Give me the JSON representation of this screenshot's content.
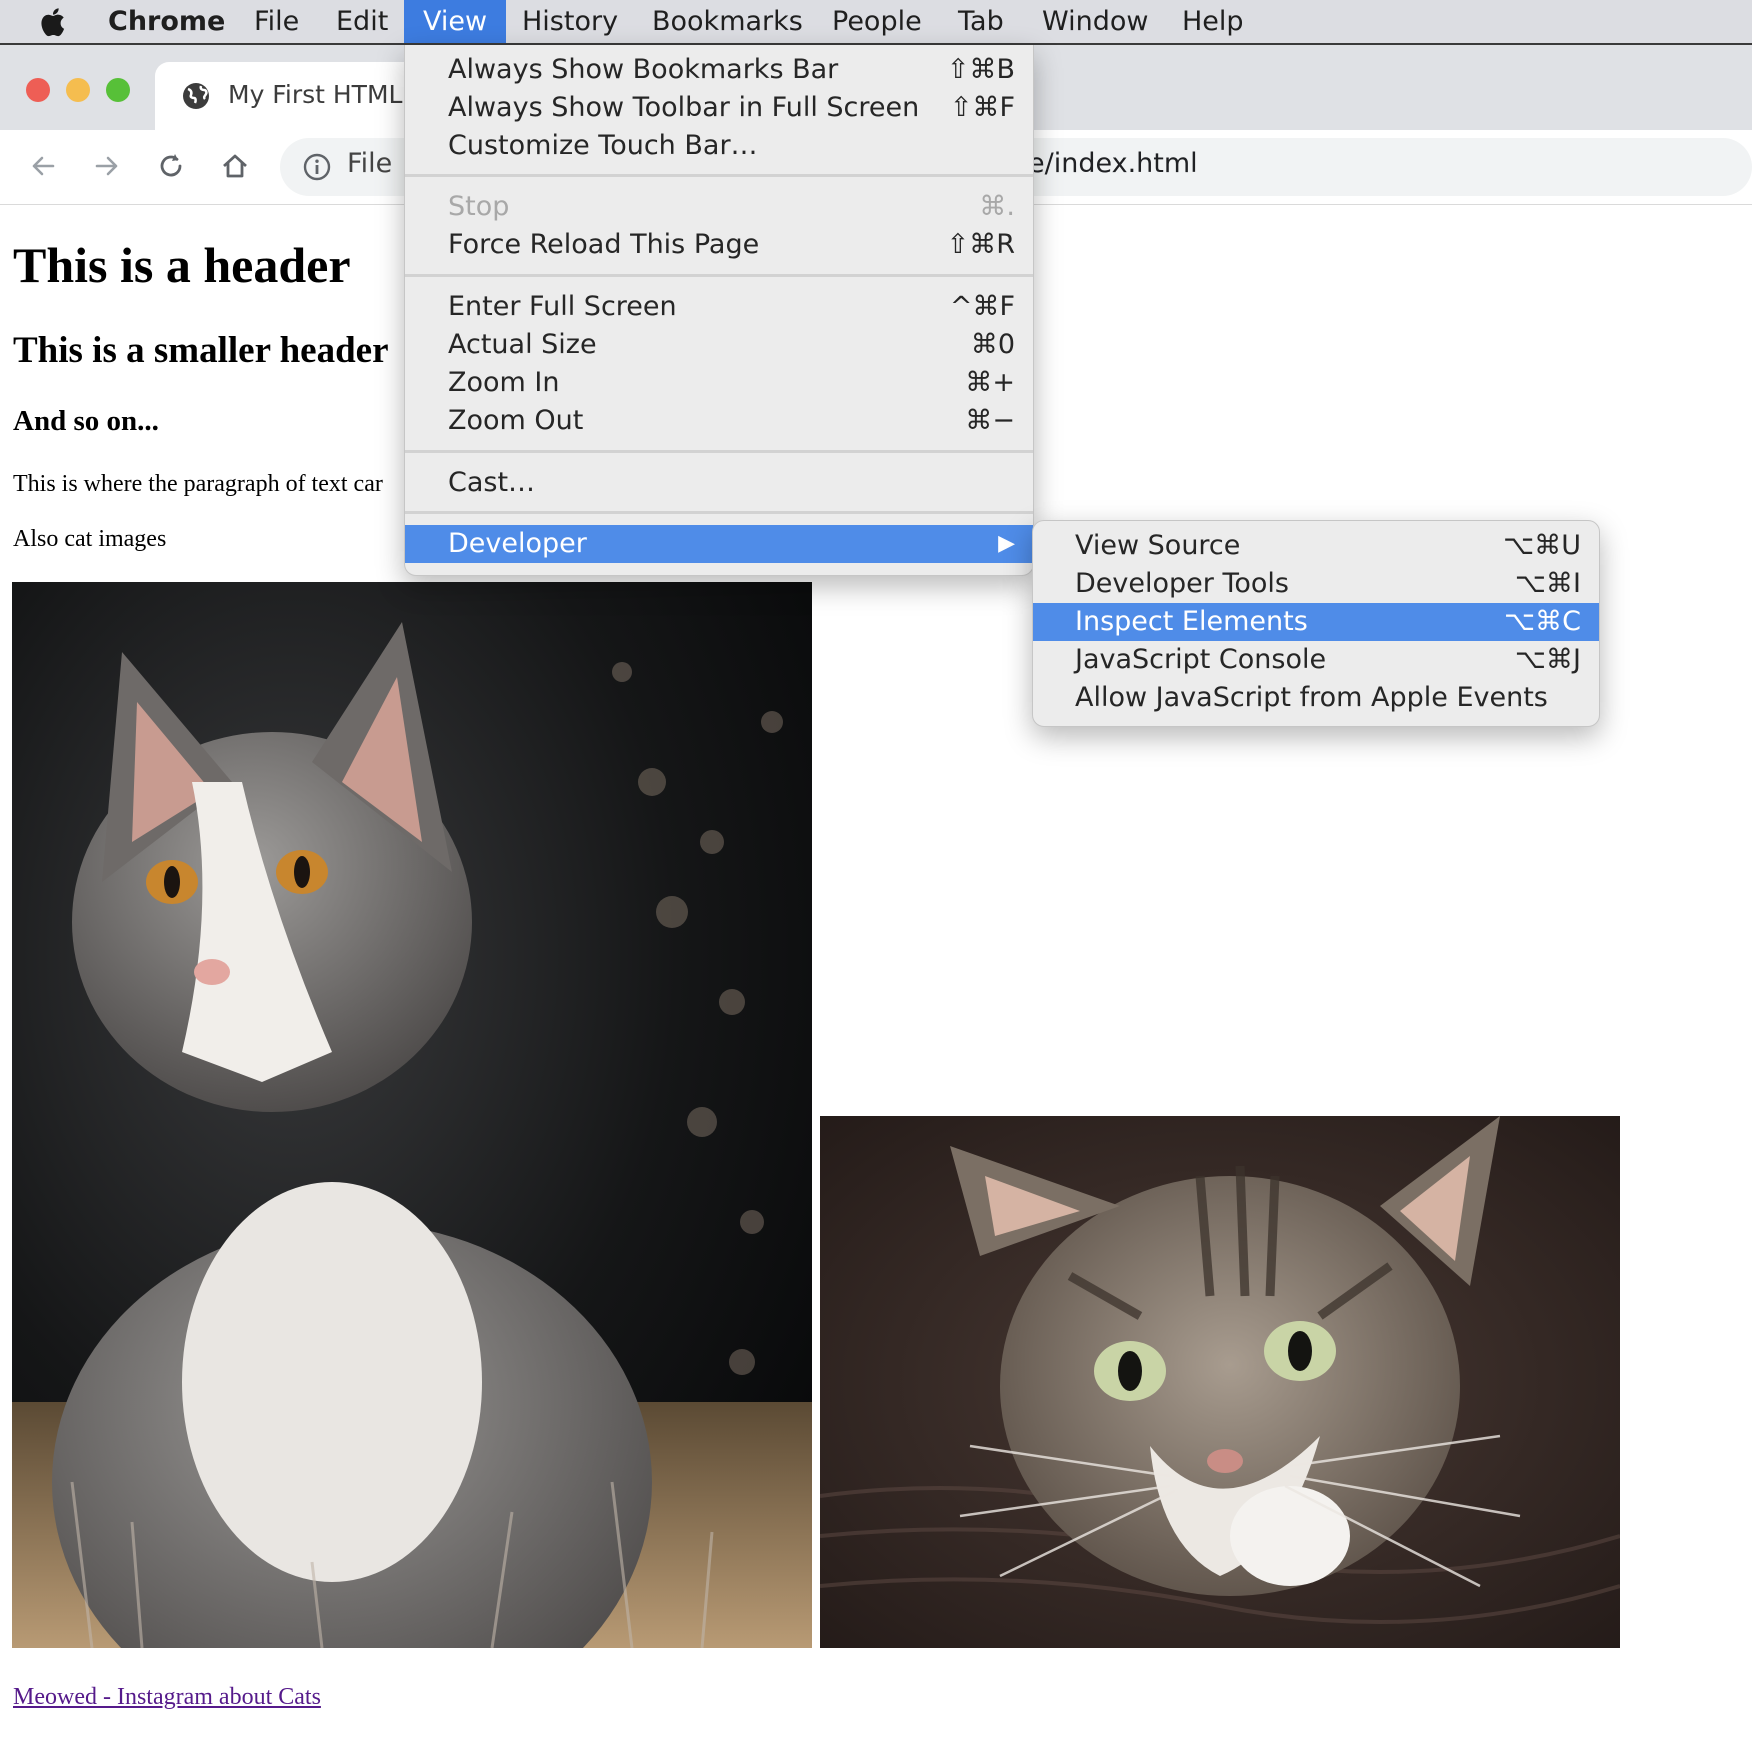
{
  "menubar": {
    "app": "Chrome",
    "items": [
      "File",
      "Edit",
      "View",
      "History",
      "Bookmarks",
      "People",
      "Tab",
      "Window",
      "Help"
    ],
    "active": "View"
  },
  "browser": {
    "tab_title": "My First HTML I",
    "address_left": "File",
    "address_right": "e/index.html"
  },
  "page": {
    "h1": "This is a header",
    "h2": "This is a smaller header",
    "h3": "And so on...",
    "paragraph": "This is where the paragraph of text car",
    "paragraph2": "Also cat images",
    "link": "Meowed - Instagram about Cats"
  },
  "view_menu": {
    "group1": [
      {
        "label": "Always Show Bookmarks Bar",
        "shortcut": "⇧⌘B"
      },
      {
        "label": "Always Show Toolbar in Full Screen",
        "shortcut": "⇧⌘F"
      },
      {
        "label": "Customize Touch Bar…",
        "shortcut": ""
      }
    ],
    "group2": [
      {
        "label": "Stop",
        "shortcut": "⌘.",
        "disabled": true
      },
      {
        "label": "Force Reload This Page",
        "shortcut": "⇧⌘R"
      }
    ],
    "group3": [
      {
        "label": "Enter Full Screen",
        "shortcut": "^⌘F"
      },
      {
        "label": "Actual Size",
        "shortcut": "⌘0"
      },
      {
        "label": "Zoom In",
        "shortcut": "⌘+"
      },
      {
        "label": "Zoom Out",
        "shortcut": "⌘−"
      }
    ],
    "group4": [
      {
        "label": "Cast…",
        "shortcut": ""
      }
    ],
    "group5": [
      {
        "label": "Developer",
        "shortcut": "▶",
        "highlighted": true
      }
    ]
  },
  "developer_menu": {
    "items": [
      {
        "label": "View Source",
        "shortcut": "⌥⌘U"
      },
      {
        "label": "Developer Tools",
        "shortcut": "⌥⌘I"
      },
      {
        "label": "Inspect Elements",
        "shortcut": "⌥⌘C",
        "highlighted": true
      },
      {
        "label": "JavaScript Console",
        "shortcut": "⌥⌘J"
      },
      {
        "label": "Allow JavaScript from Apple Events",
        "shortcut": ""
      }
    ]
  },
  "colors": {
    "menu_highlight": "#4f8ce8",
    "menubar_active": "#3d7ce0",
    "link": "#551a8b",
    "traffic_red": "#ee5e55",
    "traffic_yellow": "#f5bd4f",
    "traffic_green": "#57c038"
  },
  "icons": [
    "apple-icon",
    "globe-icon",
    "back-arrow-icon",
    "forward-arrow-icon",
    "reload-icon",
    "home-icon",
    "info-icon",
    "submenu-arrow-icon"
  ]
}
